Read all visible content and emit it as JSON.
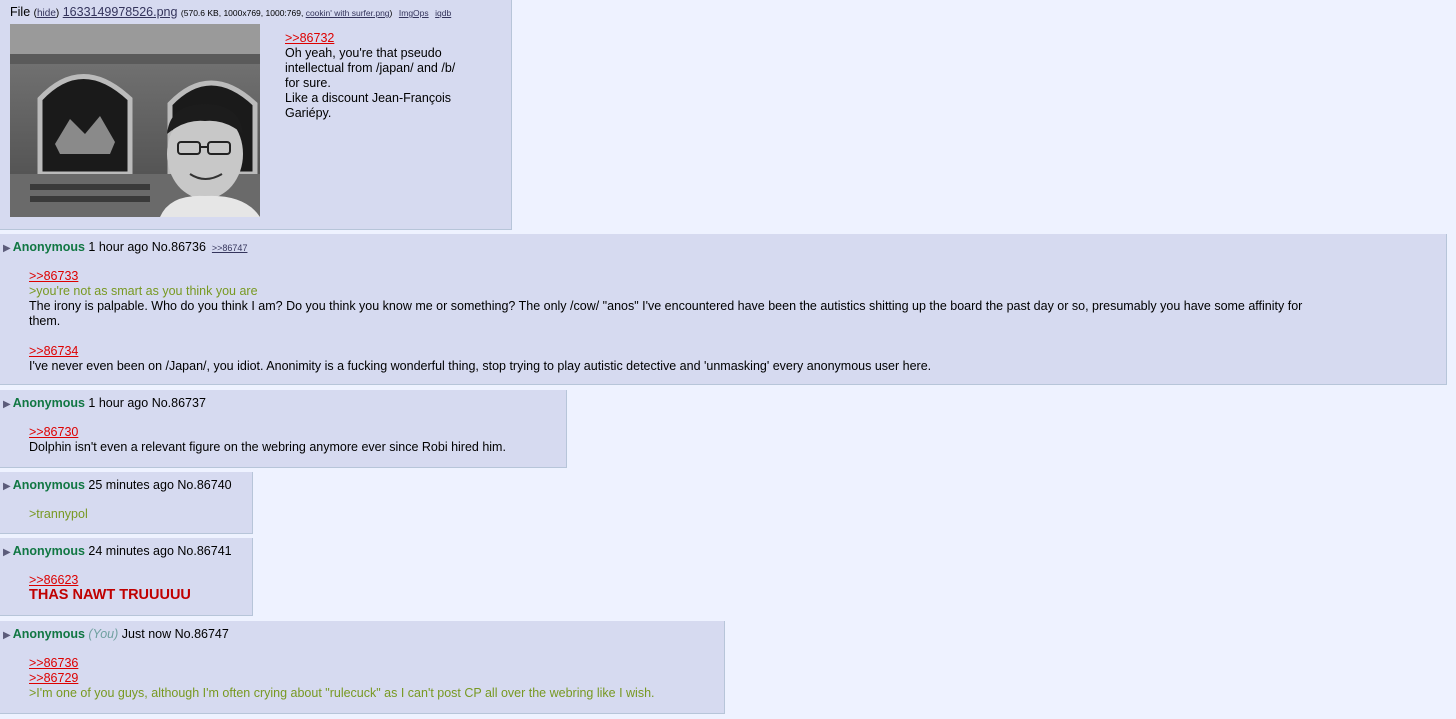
{
  "op_post": {
    "file_label": "File",
    "hide_label": "hide",
    "filename": "1633149978526.png",
    "file_meta": "(570.6 KB, 1000x769, 1000:769,",
    "original_name": "cookin' with surfer.png",
    "file_meta_close": ")",
    "imgops": "ImgOps",
    "iqdb": "iqdb",
    "lines": [
      {
        "type": "quote",
        "text": ">>86732"
      },
      {
        "type": "text",
        "text": "Oh yeah, you're that pseudo"
      },
      {
        "type": "text",
        "text": "intellectual from /japan/ and /b/"
      },
      {
        "type": "text",
        "text": "for sure."
      },
      {
        "type": "text",
        "text": "Like a discount Jean-François"
      },
      {
        "type": "text",
        "text": "Gariépy."
      }
    ]
  },
  "posts": [
    {
      "name": "Anonymous",
      "you": "",
      "time": "1 hour ago",
      "number": "No.86736",
      "backlink": ">>86747",
      "lines": [
        {
          "type": "quote",
          "text": ">>86733"
        },
        {
          "type": "green",
          "text": ">you're not as smart as you think you are"
        },
        {
          "type": "text",
          "text": "The irony is palpable. Who do you think I am? Do you think you know me or something? The only /cow/ \"anos\" I've encountered have been the autistics shitting up the board the past day or so, presumably you have some affinity for"
        },
        {
          "type": "text",
          "text": "them."
        },
        {
          "type": "gap",
          "text": ""
        },
        {
          "type": "quote",
          "text": ">>86734"
        },
        {
          "type": "text",
          "text": "I've never even been on /Japan/, you idiot. Anonimity is a fucking wonderful thing, stop trying to play autistic detective and 'unmasking' every anonymous user here."
        }
      ]
    },
    {
      "name": "Anonymous",
      "you": "",
      "time": "1 hour ago",
      "number": "No.86737",
      "backlink": "",
      "lines": [
        {
          "type": "quote",
          "text": ">>86730"
        },
        {
          "type": "text",
          "text": "Dolphin isn't even a relevant figure on the webring anymore ever since Robi hired him."
        }
      ]
    },
    {
      "name": "Anonymous",
      "you": "",
      "time": "25 minutes ago",
      "number": "No.86740",
      "backlink": "",
      "lines": [
        {
          "type": "green",
          "text": ">trannypol"
        }
      ]
    },
    {
      "name": "Anonymous",
      "you": "",
      "time": "24 minutes ago",
      "number": "No.86741",
      "backlink": "",
      "lines": [
        {
          "type": "quote",
          "text": ">>86623"
        },
        {
          "type": "bigred",
          "text": "THAS NAWT TRUUUUU"
        }
      ]
    },
    {
      "name": "Anonymous",
      "you": "(You)",
      "time": "Just now",
      "number": "No.86747",
      "backlink": "",
      "lines": [
        {
          "type": "quote",
          "text": ">>86736"
        },
        {
          "type": "quote",
          "text": ">>86729"
        },
        {
          "type": "green",
          "text": ">I'm one of you guys, although I'm often crying about \"rulecuck\" as I can't post CP all over the webring like I wish."
        }
      ]
    }
  ],
  "colors": {
    "background": "#eef2ff",
    "post_bg": "#d6daf0",
    "name": "#117743",
    "quote_link": "#dd0000",
    "greentext": "#789922"
  }
}
